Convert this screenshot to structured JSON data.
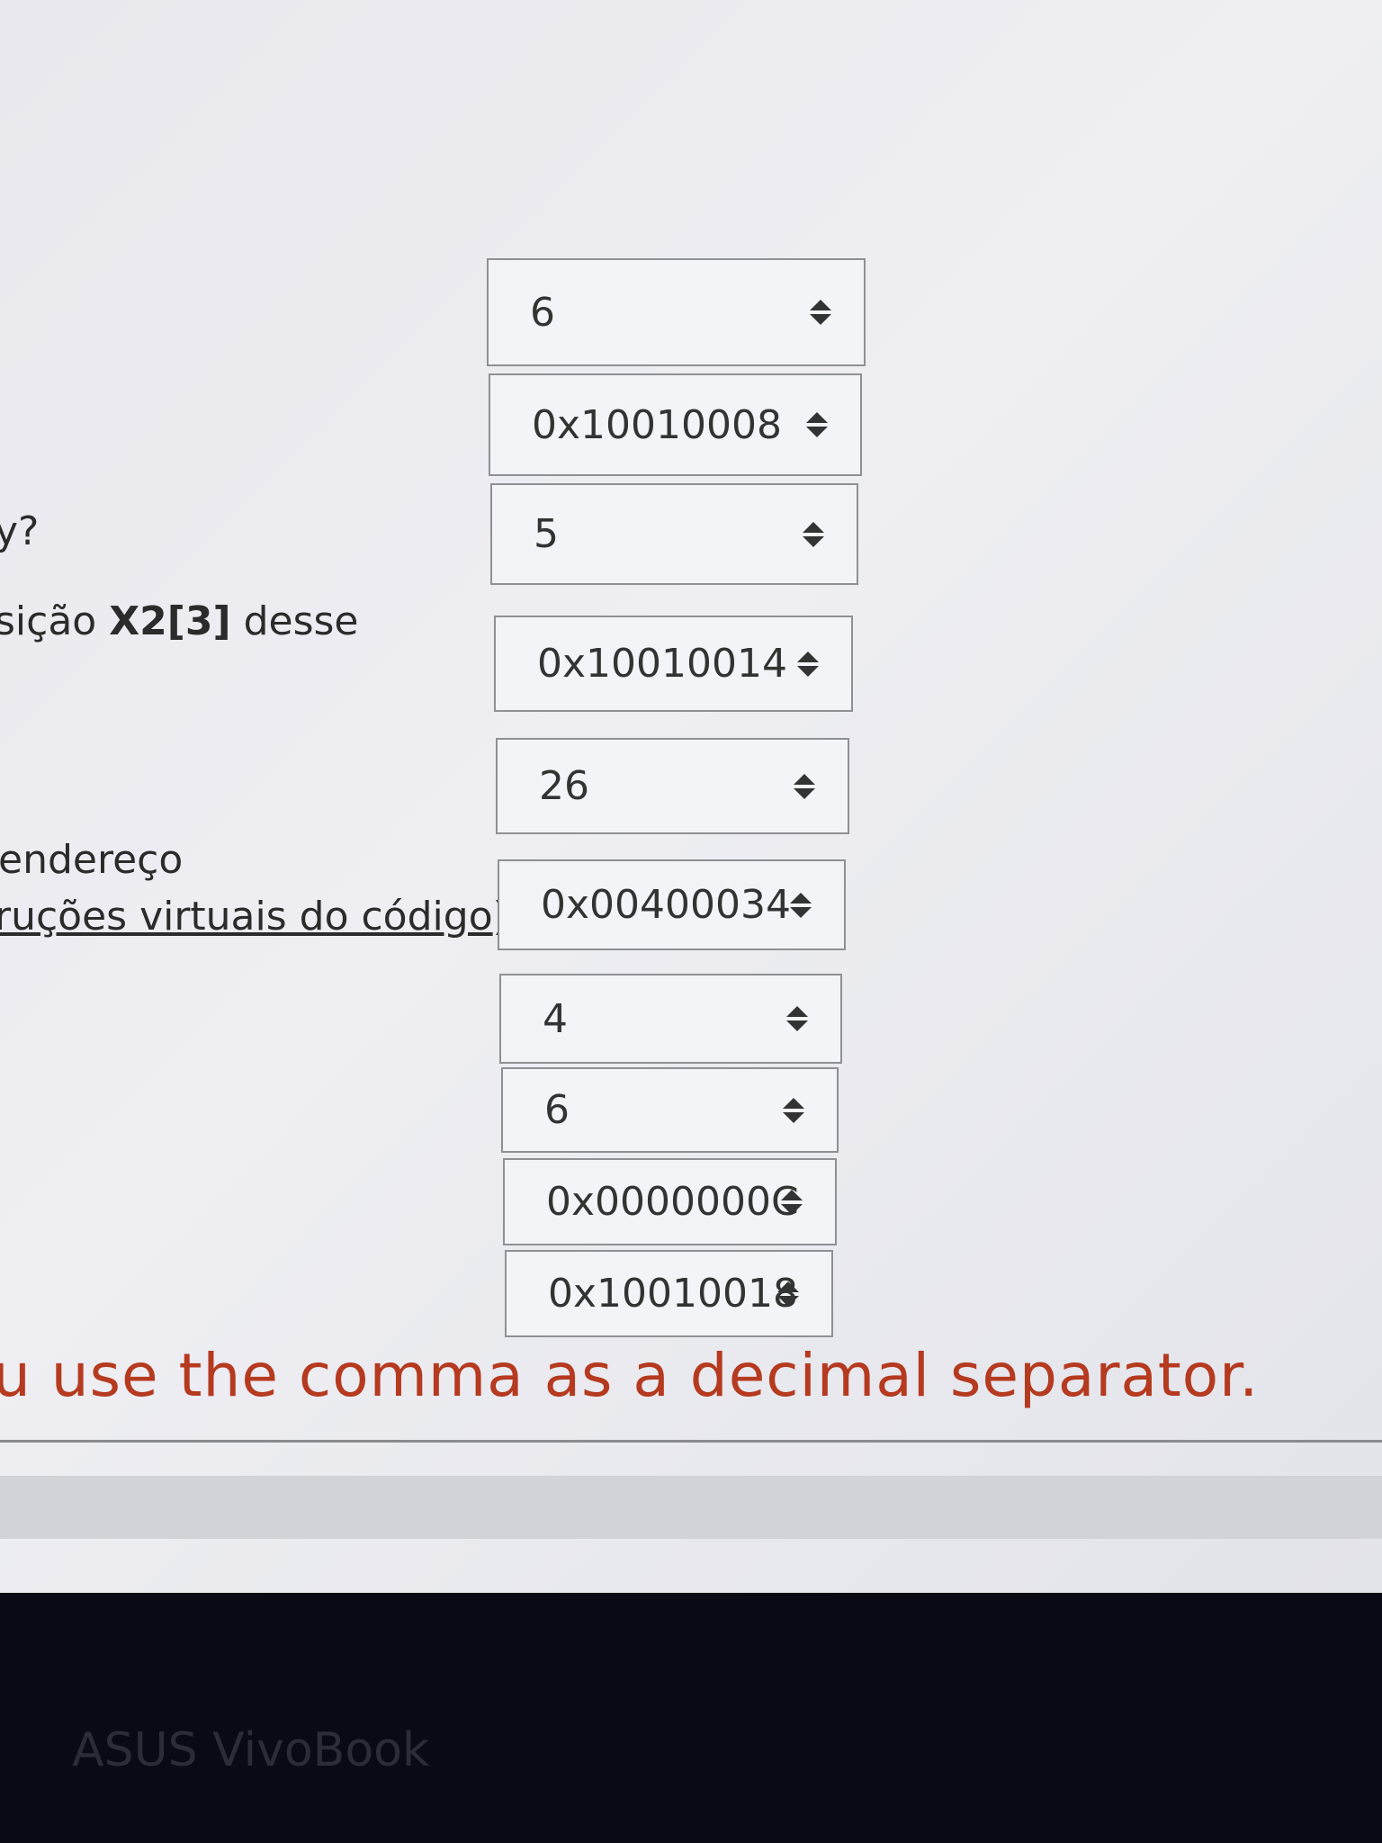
{
  "question_fragments": {
    "q3_fragment": "y?",
    "q4_fragment_pre": "sição ",
    "q4_fragment_bold": "X2[3]",
    "q4_fragment_post": " desse",
    "q6_fragment_line1": " endereço",
    "q6_fragment_line2_link": "ruções virtuais do código",
    "q6_fragment_line2_end": ")."
  },
  "answers": [
    {
      "value": "6"
    },
    {
      "value": "0x10010008"
    },
    {
      "value": "5"
    },
    {
      "value": "0x10010014"
    },
    {
      "value": "26"
    },
    {
      "value": "0x00400034"
    },
    {
      "value": "4"
    },
    {
      "value": "6"
    },
    {
      "value": "0x0000000C"
    },
    {
      "value": "0x10010018"
    }
  ],
  "notice": "u use the comma as a decimal separator.",
  "bezel_brand": "ASUS VivoBook",
  "colors": {
    "notice": "#b53a1f",
    "bezel": "#0a0a14"
  },
  "icons": {
    "select_arrows": "up-down-arrows-icon"
  }
}
